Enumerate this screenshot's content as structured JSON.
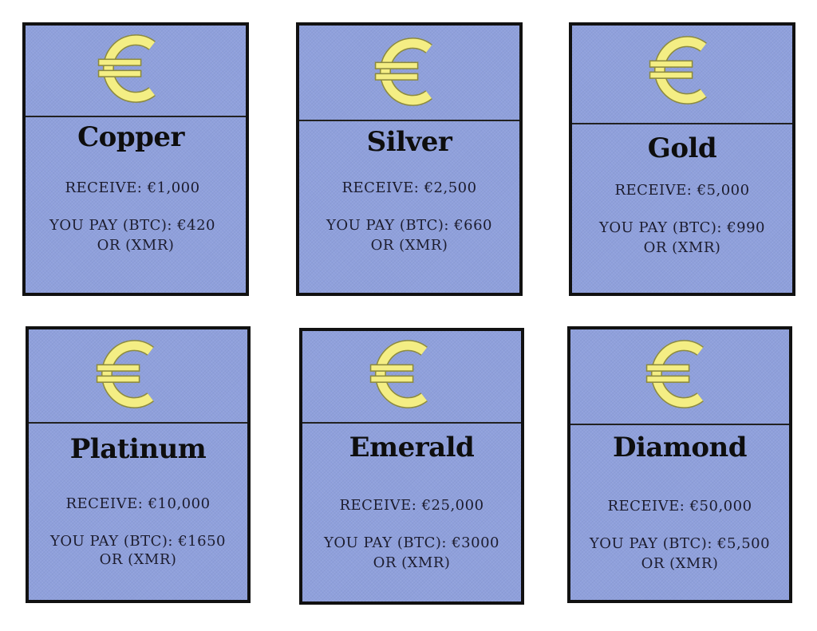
{
  "cards": [
    {
      "name": "Copper",
      "receive": "RECEIVE: €1,000",
      "pay": "YOU PAY (BTC): €420",
      "alt": "OR (XMR)"
    },
    {
      "name": "Silver",
      "receive": "RECEIVE: €2,500",
      "pay": "YOU PAY (BTC): €660",
      "alt": "OR (XMR)"
    },
    {
      "name": "Gold",
      "receive": "RECEIVE: €5,000",
      "pay": "YOU PAY (BTC): €990",
      "alt": "OR (XMR)"
    },
    {
      "name": "Platinum",
      "receive": "RECEIVE: €10,000",
      "pay": "YOU PAY (BTC): €1650",
      "alt": "OR (XMR)"
    },
    {
      "name": "Emerald",
      "receive": "RECEIVE: €25,000",
      "pay": "YOU PAY (BTC): €3000",
      "alt": "OR (XMR)"
    },
    {
      "name": "Diamond",
      "receive": "RECEIVE: €50,000",
      "pay": "YOU PAY (BTC): €5,500",
      "alt": "OR (XMR)"
    }
  ],
  "icons": {
    "symbol": "euro-icon"
  },
  "colors": {
    "card_background": "#8fa0dc",
    "border": "#111111",
    "euro_fill": "#f4ee84",
    "euro_stroke": "#8c8a3e"
  }
}
